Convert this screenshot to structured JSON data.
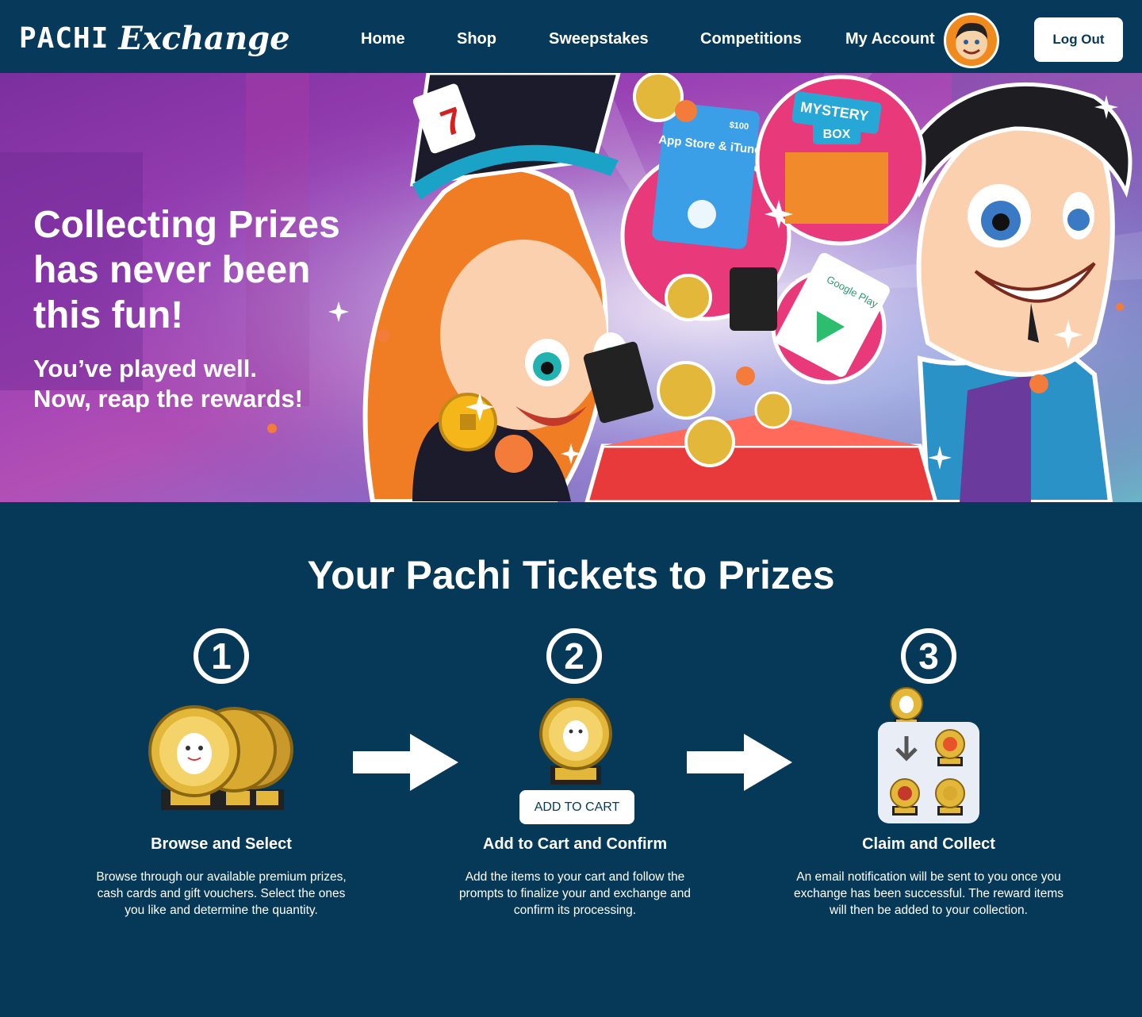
{
  "nav": {
    "logo_pachi": "PACHI",
    "logo_exchange": "Exchange",
    "links": [
      "Home",
      "Shop",
      "Sweepstakes",
      "Competitions",
      "My Account"
    ],
    "logout_label": "Log Out"
  },
  "hero": {
    "title": "Collecting Prizes has never been this fun!",
    "subtitle": "You’ve played well.\nNow, reap the rewards!",
    "card_app_store": "App Store & iTunes",
    "card_amount": "$100",
    "mystery": "MYSTERY",
    "box": "BOX",
    "google_play": "Google Play"
  },
  "steps_section": {
    "title": "Your Pachi Tickets to Prizes",
    "steps": [
      {
        "number": "1",
        "title": "Browse and Select",
        "description": "Browse through our available premium prizes, cash cards and gift vouchers.  Select the ones you like and determine the quantity."
      },
      {
        "number": "2",
        "title": "Add to Cart and Confirm",
        "description": "Add the items to your cart and follow the prompts to finalize your and exchange and confirm its processing."
      },
      {
        "number": "3",
        "title": "Claim and Collect",
        "description": "An email notification will be sent to you once you exchange has been successful.  The reward items will then be added to your collection."
      }
    ],
    "add_to_cart_label": "ADD TO CART"
  },
  "colors": {
    "navy": "#06395a",
    "hero_purple": "#9b3fb5",
    "coin_gold": "#e2b73a"
  }
}
